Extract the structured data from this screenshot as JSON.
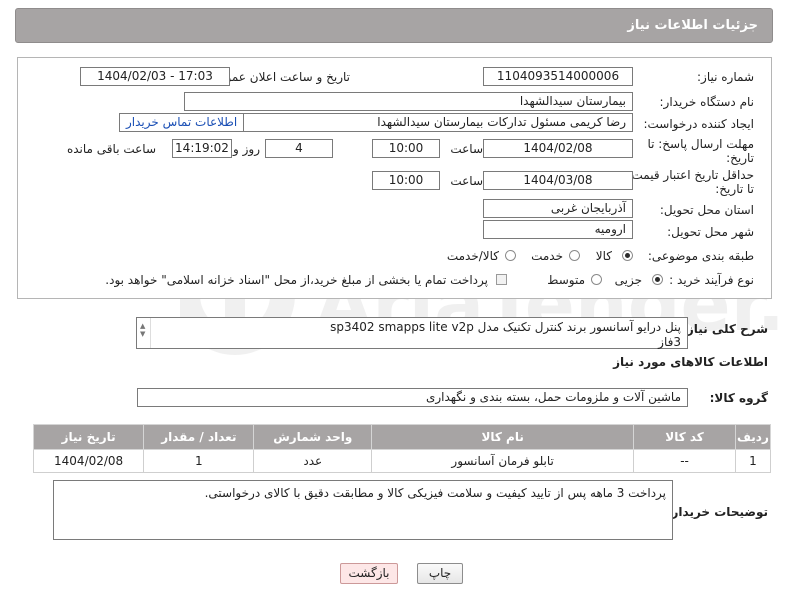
{
  "header": {
    "title": "جزئیات اطلاعات نیاز"
  },
  "form": {
    "need_number_label": "شماره نیاز:",
    "need_number": "1104093514000006",
    "announce_label": "تاریخ و ساعت اعلان عمومی:",
    "announce_value": "1404/02/03 - 17:03",
    "buyer_org_label": "نام دستگاه خریدار:",
    "buyer_org": "بیمارستان سیدالشهدا",
    "requester_label": "ایجاد کننده درخواست:",
    "requester": "رضا کریمی مسئول تدارکات بیمارستان سیدالشهدا",
    "contact_link": "اطلاعات تماس خریدار",
    "deadline_label_1": "مهلت ارسال پاسخ: تا",
    "deadline_label_2": "تاریخ:",
    "deadline_date": "1404/02/08",
    "time_label": "ساعت",
    "deadline_time": "10:00",
    "days_value": "4",
    "days_label": "روز و",
    "remaining_time": "14:19:02",
    "remaining_label": "ساعت باقی مانده",
    "validity_label_1": "حداقل تاریخ اعتبار قیمت:",
    "validity_label_2": "تا تاریخ:",
    "validity_date": "1404/03/08",
    "validity_time": "10:00",
    "province_label": "استان محل تحویل:",
    "province": "آذربایجان غربی",
    "city_label": "شهر محل تحویل:",
    "city": "ارومیه",
    "category_label": "طبقه بندی موضوعی:",
    "category_options": [
      "کالا",
      "خدمت",
      "کالا/خدمت"
    ],
    "category_selected": "کالا",
    "process_label": "نوع فرآیند خرید :",
    "process_options": [
      "جزیی",
      "متوسط"
    ],
    "process_selected": "جزیی",
    "payment_note": "پرداخت تمام یا بخشی از مبلغ خرید،از محل \"اسناد خزانه اسلامی\" خواهد بود."
  },
  "description": {
    "label": "شرح کلی نیاز:",
    "line1": "پنل درایو آسانسور برند کنترل تکنیک مدل sp3402 smapps lite v2p",
    "line2": "3فاز"
  },
  "goods": {
    "section_title": "اطلاعات کالاهای مورد نیاز",
    "group_label": "گروه کالا:",
    "group_value": "ماشین آلات و ملزومات حمل، بسته بندی و نگهداری",
    "columns": [
      "ردیف",
      "کد کالا",
      "نام کالا",
      "واحد شمارش",
      "تعداد / مقدار",
      "تاریخ نیاز"
    ],
    "rows": [
      {
        "row": "1",
        "code": "--",
        "name": "تابلو فرمان آسانسور",
        "unit": "عدد",
        "qty": "1",
        "date": "1404/02/08"
      }
    ]
  },
  "notes": {
    "label": "توضیحات خریدار:",
    "text": "پرداخت 3 ماهه پس از تایید کیفیت و سلامت فیزیکی کالا و مطابقت دقیق با کالای درخواستی."
  },
  "buttons": {
    "print": "چاپ",
    "back": "بازگشت"
  },
  "watermark": {
    "text": "AriaTender.neT"
  },
  "colors": {
    "header_bg": "#a7a4a4",
    "link": "#1a4fb5",
    "back_btn": "#fde7e7"
  }
}
